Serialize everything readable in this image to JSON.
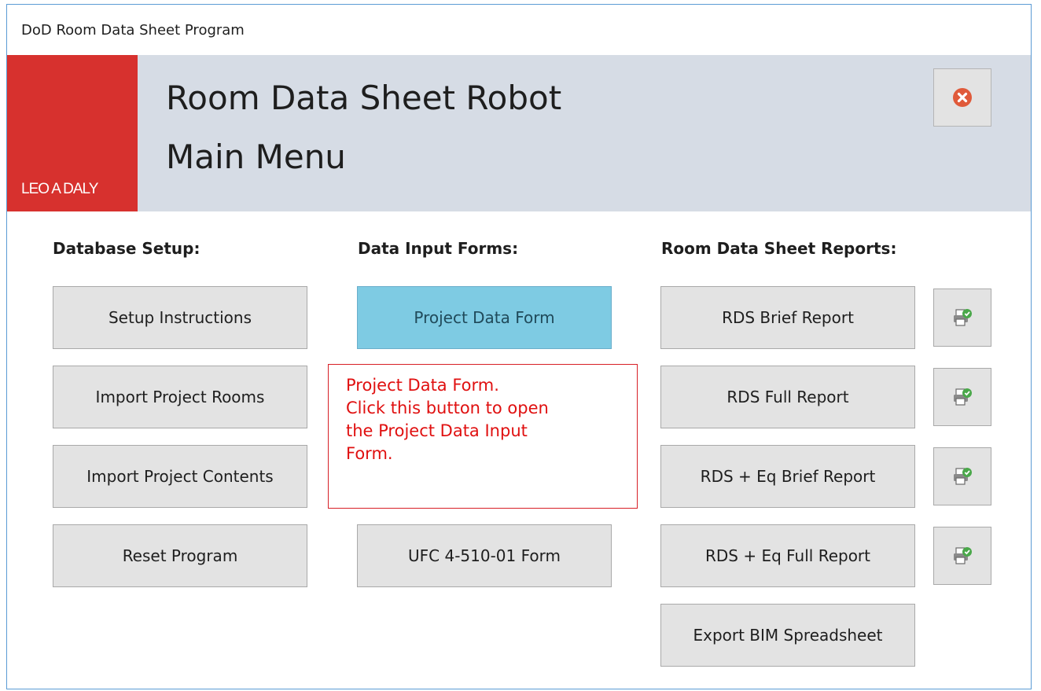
{
  "window": {
    "title": "DoD Room Data Sheet Program"
  },
  "header": {
    "logo_text": "LEO A DALY",
    "title_line1": "Room Data Sheet Robot",
    "title_line2": "Main Menu",
    "brand_color": "#d7312e",
    "close_icon": "close-circle-icon"
  },
  "sections": {
    "database_setup": {
      "heading": "Database Setup:",
      "buttons": [
        "Setup Instructions",
        "Import Project Rooms",
        "Import Project Contents",
        "Reset Program"
      ]
    },
    "data_input": {
      "heading": "Data Input Forms:",
      "buttons": [
        "Project Data Form",
        "UFC 4-510-01 Form"
      ]
    },
    "reports": {
      "heading": "Room Data Sheet Reports:",
      "buttons": [
        "RDS Brief Report",
        "RDS Full Report",
        "RDS + Eq Brief Report",
        "RDS + Eq Full Report",
        "Export BIM Spreadsheet"
      ],
      "print_icon": "print-preview-icon"
    }
  },
  "tooltip": {
    "lines": [
      "Project Data Form.",
      "Click this button to open",
      "the Project Data Input",
      "Form."
    ],
    "color": "#e01010"
  }
}
